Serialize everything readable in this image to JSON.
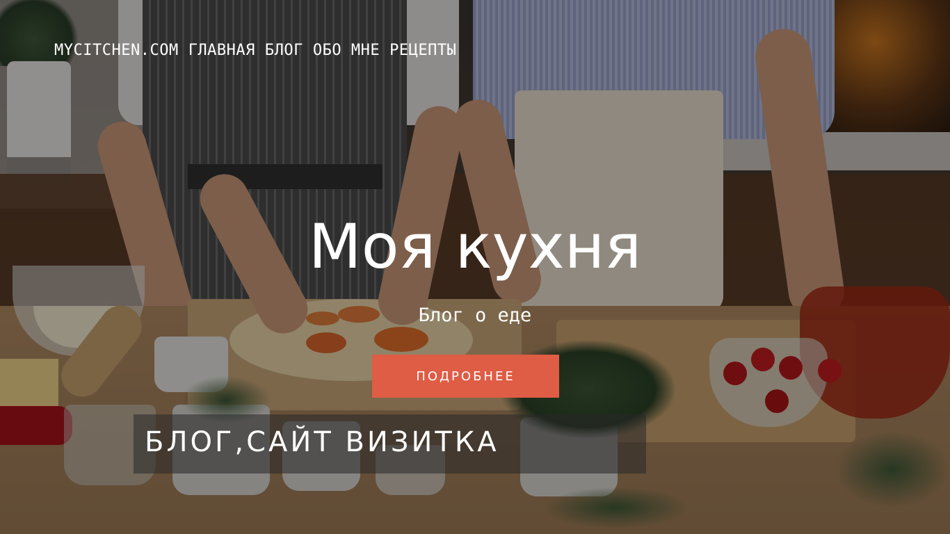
{
  "header": {
    "brand": "MYCITCHEN.COM",
    "nav": [
      {
        "label": "ГЛАВНАЯ"
      },
      {
        "label": "БЛОГ"
      },
      {
        "label": "ОБО МНЕ"
      },
      {
        "label": "РЕЦЕПТЫ"
      }
    ]
  },
  "hero": {
    "title": "Моя кухня",
    "subtitle": "Блог о еде",
    "button_label": "ПОДРОБНЕЕ",
    "tagline": "БЛОГ,САЙТ ВИЗИТКА"
  },
  "colors": {
    "accent": "#df5c45",
    "text": "#ffffff"
  }
}
